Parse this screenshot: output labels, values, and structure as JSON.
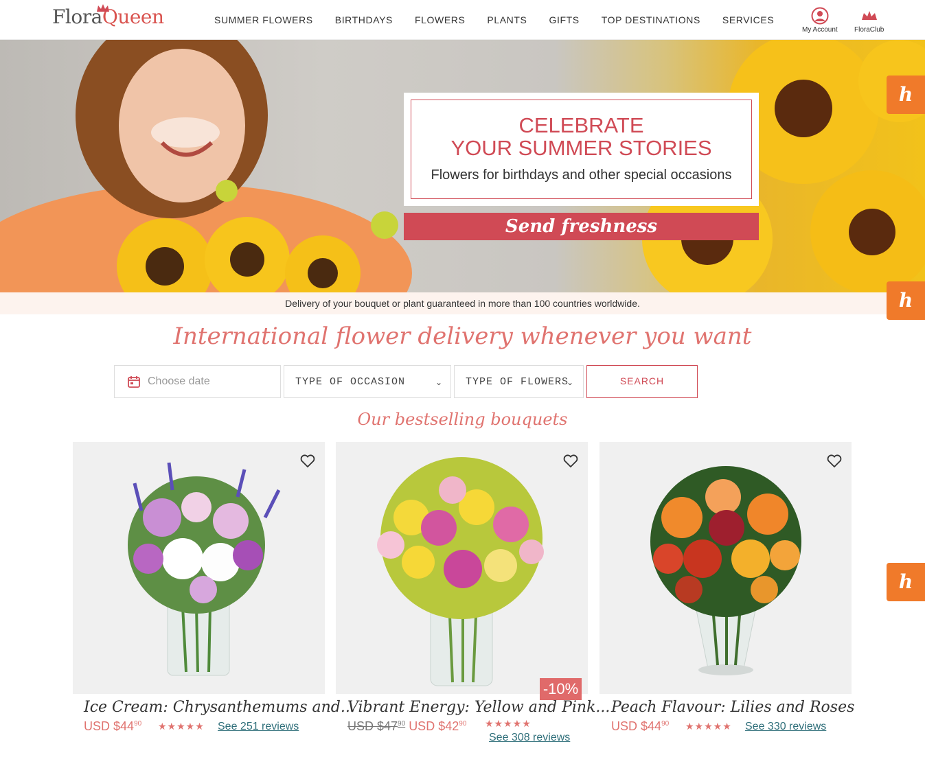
{
  "header": {
    "logo_left": "Flora",
    "logo_right": "Queen",
    "nav": [
      "SUMMER FLOWERS",
      "BIRTHDAYS",
      "FLOWERS",
      "PLANTS",
      "GIFTS",
      "TOP DESTINATIONS",
      "SERVICES"
    ],
    "account_label": "My Account",
    "club_label": "FloraClub"
  },
  "hero": {
    "title_line1": "CELEBRATE",
    "title_line2": "YOUR SUMMER STORIES",
    "subtitle": "Flowers for birthdays and other special occasions",
    "cta": "Send freshness"
  },
  "delivery_note": "Delivery of your bouquet or plant guaranteed in more than 100 countries worldwide.",
  "side_badge": "h",
  "tagline": "International flower delivery whenever you want",
  "search": {
    "date_placeholder": "Choose date",
    "occasion": "TYPE OF OCCASION",
    "flowers": "TYPE OF FLOWERS",
    "button": "SEARCH"
  },
  "section_title": "Our bestselling bouquets",
  "products": [
    {
      "name": "Ice Cream: Chrysanthemums and...",
      "currency": "USD",
      "price": "$44",
      "cents": "90",
      "rating_stars": "★★★★★",
      "reviews": "See 251 reviews"
    },
    {
      "name": "Vibrant Energy: Yellow and Pink...",
      "currency": "USD",
      "old_price": "USD $47",
      "old_cents": "90",
      "price": "$42",
      "cents": "90",
      "discount": "-10%",
      "rating_stars": "★★★★★",
      "reviews": "See 308 reviews"
    },
    {
      "name": "Peach Flavour: Lilies and Roses",
      "currency": "USD",
      "price": "$44",
      "cents": "90",
      "rating_stars": "★★★★★",
      "reviews": "See 330 reviews"
    }
  ],
  "colors": {
    "brand": "#d04a55",
    "accent": "#e0736f",
    "badge": "#f07a2a"
  }
}
